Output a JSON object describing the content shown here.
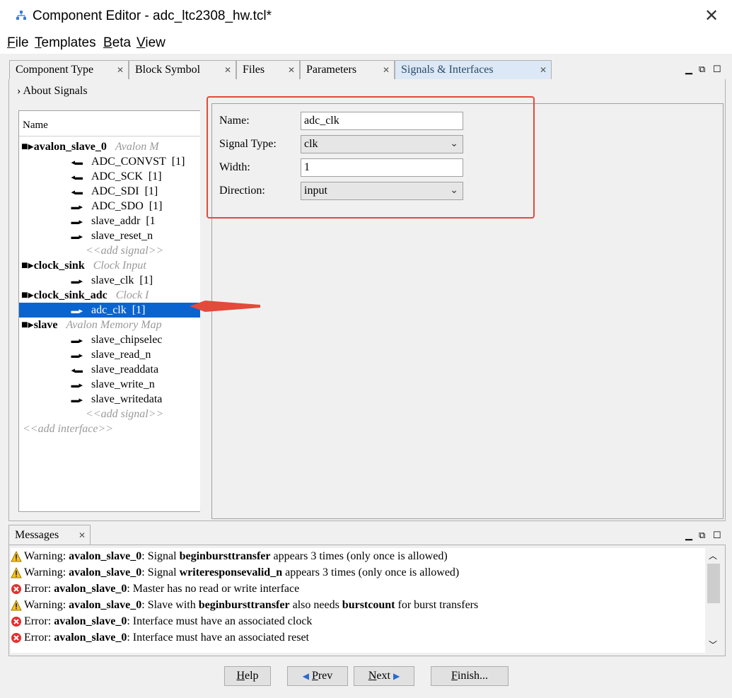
{
  "window": {
    "title": "Component Editor - adc_ltc2308_hw.tcl*",
    "close_glyph": "✕"
  },
  "menubar": {
    "items": [
      {
        "key": "F",
        "rest": "ile"
      },
      {
        "key": "T",
        "rest": "emplates"
      },
      {
        "key": "B",
        "rest": "eta"
      },
      {
        "key": "V",
        "rest": "iew"
      }
    ]
  },
  "tabs": [
    {
      "label": "Component Type",
      "active": false
    },
    {
      "label": "Block Symbol",
      "active": false
    },
    {
      "label": "Files",
      "active": false
    },
    {
      "label": "Parameters",
      "active": false
    },
    {
      "label": "Signals & Interfaces",
      "active": true
    }
  ],
  "about": "About Signals",
  "tree": {
    "header": "Name",
    "rows": [
      {
        "kind": "interface",
        "name": "avalon_slave_0",
        "type": "Avalon M"
      },
      {
        "kind": "signal",
        "dir": "out",
        "name": "ADC_CONVST",
        "width": "[1]"
      },
      {
        "kind": "signal",
        "dir": "out",
        "name": "ADC_SCK",
        "width": "[1]"
      },
      {
        "kind": "signal",
        "dir": "out",
        "name": "ADC_SDI",
        "width": "[1]"
      },
      {
        "kind": "signal",
        "dir": "in",
        "name": "ADC_SDO",
        "width": "[1]"
      },
      {
        "kind": "signal",
        "dir": "in",
        "name": "slave_addr",
        "width": "[1"
      },
      {
        "kind": "signal",
        "dir": "in",
        "name": "slave_reset_n",
        "width": ""
      },
      {
        "kind": "add",
        "label": "<<add signal>>"
      },
      {
        "kind": "interface",
        "name": "clock_sink",
        "type": "Clock Input"
      },
      {
        "kind": "signal",
        "dir": "in",
        "name": "slave_clk",
        "width": "[1]"
      },
      {
        "kind": "interface",
        "name": "clock_sink_adc",
        "type": "Clock I"
      },
      {
        "kind": "signal",
        "dir": "in",
        "name": "adc_clk",
        "width": "[1]",
        "selected": true
      },
      {
        "kind": "interface",
        "name": "slave",
        "type": "Avalon Memory Map"
      },
      {
        "kind": "signal",
        "dir": "in",
        "name": "slave_chipselec",
        "width": ""
      },
      {
        "kind": "signal",
        "dir": "in",
        "name": "slave_read_n",
        "width": ""
      },
      {
        "kind": "signal",
        "dir": "out",
        "name": "slave_readdata",
        "width": ""
      },
      {
        "kind": "signal",
        "dir": "in",
        "name": "slave_write_n",
        "width": ""
      },
      {
        "kind": "signal",
        "dir": "in",
        "name": "slave_writedata",
        "width": ""
      },
      {
        "kind": "add",
        "label": "<<add signal>>"
      },
      {
        "kind": "add-root",
        "label": "<<add interface>>"
      }
    ]
  },
  "detail": {
    "name_label": "Name:",
    "name_value": "adc_clk",
    "type_label": "Signal Type:",
    "type_value": "clk",
    "width_label": "Width:",
    "width_value": "1",
    "direction_label": "Direction:",
    "direction_value": "input"
  },
  "messages": {
    "tab_label": "Messages",
    "items": [
      {
        "level": "warning",
        "prefix": "Warning:",
        "parts": [
          [
            "b",
            "avalon_slave_0"
          ],
          [
            "t",
            ": Signal "
          ],
          [
            "b",
            "beginbursttransfer"
          ],
          [
            "t",
            " appears 3 times (only once is allowed)"
          ]
        ]
      },
      {
        "level": "warning",
        "prefix": "Warning:",
        "parts": [
          [
            "b",
            "avalon_slave_0"
          ],
          [
            "t",
            ": Signal "
          ],
          [
            "b",
            "writeresponsevalid_n"
          ],
          [
            "t",
            " appears 3 times (only once is allowed)"
          ]
        ]
      },
      {
        "level": "error",
        "prefix": "Error:",
        "parts": [
          [
            "b",
            "avalon_slave_0"
          ],
          [
            "t",
            ": Master has no read or write interface"
          ]
        ]
      },
      {
        "level": "warning",
        "prefix": "Warning:",
        "parts": [
          [
            "b",
            "avalon_slave_0"
          ],
          [
            "t",
            ": Slave with "
          ],
          [
            "b",
            "beginbursttransfer"
          ],
          [
            "t",
            " also needs "
          ],
          [
            "b",
            "burstcount"
          ],
          [
            "t",
            " for burst transfers"
          ]
        ]
      },
      {
        "level": "error",
        "prefix": "Error:",
        "parts": [
          [
            "b",
            "avalon_slave_0"
          ],
          [
            "t",
            ": Interface must have an associated clock"
          ]
        ]
      },
      {
        "level": "error",
        "prefix": "Error:",
        "parts": [
          [
            "b",
            "avalon_slave_0"
          ],
          [
            "t",
            ": Interface must have an associated reset"
          ]
        ]
      }
    ]
  },
  "buttons": {
    "help": {
      "key": "H",
      "rest": "elp"
    },
    "prev": {
      "key": "P",
      "rest": "rev"
    },
    "next": {
      "key": "N",
      "rest": "ext"
    },
    "finish": {
      "key": "F",
      "rest": "inish..."
    }
  },
  "colors": {
    "selection": "#0a64d0",
    "highlight_box": "#e24a3a",
    "active_tab": "#dce8f5"
  }
}
